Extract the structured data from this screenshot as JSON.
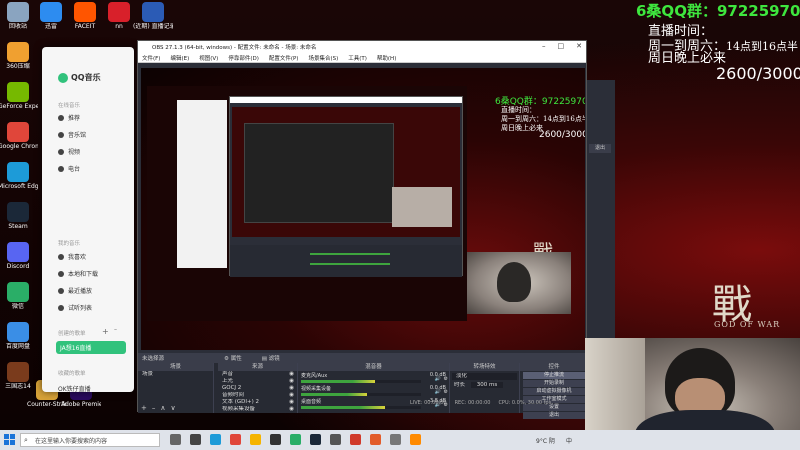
{
  "overlay": {
    "qq_group": "6桑QQ群：972259706",
    "schedule_title": "直播时间：",
    "schedule_weekday_prefix": "周一到周六：",
    "schedule_weekday_hours": "14点到16点半",
    "schedule_sunday": "周日晚上必来",
    "counter": "2600/3000",
    "brand": "戰",
    "brand_sub": "GOD OF WAR"
  },
  "desktop_icons": [
    {
      "label": "回收站",
      "color": "#8aa4c0"
    },
    {
      "label": "360压缩",
      "color": "#f0a030"
    },
    {
      "label": "GeForce Experience",
      "color": "#76b900"
    },
    {
      "label": "Google Chrome",
      "color": "#e0463a"
    },
    {
      "label": "Microsoft Edge",
      "color": "#1d9bd8"
    },
    {
      "label": "Steam",
      "color": "#1b2838"
    },
    {
      "label": "Discord",
      "color": "#5865f2"
    },
    {
      "label": "微信",
      "color": "#2aae67"
    },
    {
      "label": "百度网盘",
      "color": "#3a8ee6"
    },
    {
      "label": "三国志14",
      "color": "#7a3b1c"
    }
  ],
  "desktop_icons_col2": [
    {
      "label": "迅雷",
      "color": "#2d8cf0"
    },
    {
      "label": "FACEIT",
      "color": "#ff5500"
    },
    {
      "label": "nn",
      "color": "#d8202a"
    },
    {
      "label": "(近期) 直播记录",
      "color": "#2b5bb5"
    },
    {
      "label": "Counter-Strike Global Off...",
      "color": "#d7a238"
    },
    {
      "label": "Adobe Premie...",
      "color": "#2a0a5e"
    }
  ],
  "qqmusic": {
    "app_name": "QQ音乐",
    "section_online": "在线音乐",
    "items_online": [
      "推荐",
      "音乐馆",
      "视频",
      "电台"
    ],
    "section_mine": "我的音乐",
    "items_mine": [
      "我喜欢",
      "本地和下载",
      "最近播放",
      "试听列表"
    ],
    "section_created": "创建的歌单",
    "active_item": "JA想16直播",
    "section_collected": "收藏的歌单",
    "collected_item": "OK铁仔直播"
  },
  "obs": {
    "title": "OBS 27.1.3 (64-bit, windows) - 配置文件: 未命名 - 场景: 未命名",
    "menu": [
      "文件(F)",
      "编辑(E)",
      "视图(V)",
      "停靠部件(D)",
      "配置文件(P)",
      "场景集合(S)",
      "工具(T)",
      "帮助(H)"
    ],
    "toolbar_mode": "未选择源",
    "toolbar_props": "属性",
    "toolbar_filters": "滤镜",
    "docks": {
      "scenes": {
        "title": "场景",
        "items": [
          "场景"
        ]
      },
      "sources": {
        "title": "来源",
        "items": [
          "声音",
          "上光",
          "GOCJ 2",
          "音频时间",
          "文本 (GDI+) 2",
          "视频采集设备"
        ]
      },
      "mixer": {
        "title": "混音器",
        "channels": [
          {
            "name": "麦克风/Aux",
            "db": "0.0 dB",
            "level": 0.62
          },
          {
            "name": "视频采集设备",
            "db": "0.0 dB",
            "level": 0.55
          },
          {
            "name": "桌面音频",
            "db": "-3.8 dB",
            "level": 0.7
          }
        ]
      },
      "transitions": {
        "title": "转场特效",
        "type": "淡化",
        "duration_label": "时长",
        "duration": "300 ms"
      },
      "controls": {
        "title": "控件",
        "buttons": [
          "停止推流",
          "开始录制",
          "启动虚拟摄像机",
          "工作室模式",
          "设置",
          "退出"
        ]
      }
    },
    "status": {
      "live": "LIVE: 00:00:00",
      "rec": "REC: 00:00:00",
      "cpu": "CPU: 0.0%, 30.00 fps"
    }
  },
  "side_obs": {
    "dock_button": "退出"
  },
  "taskbar": {
    "search_placeholder": "在这里输入你要搜索的内容",
    "weather": "9°C 阴",
    "lang": "中",
    "colors": [
      "#666",
      "#444",
      "#1d9bd8",
      "#e0463a",
      "#f5b400",
      "#333",
      "#2aae67",
      "#1b2838",
      "#555",
      "#d03a2a",
      "#e25c2a",
      "#777",
      "#ff8a00"
    ]
  }
}
